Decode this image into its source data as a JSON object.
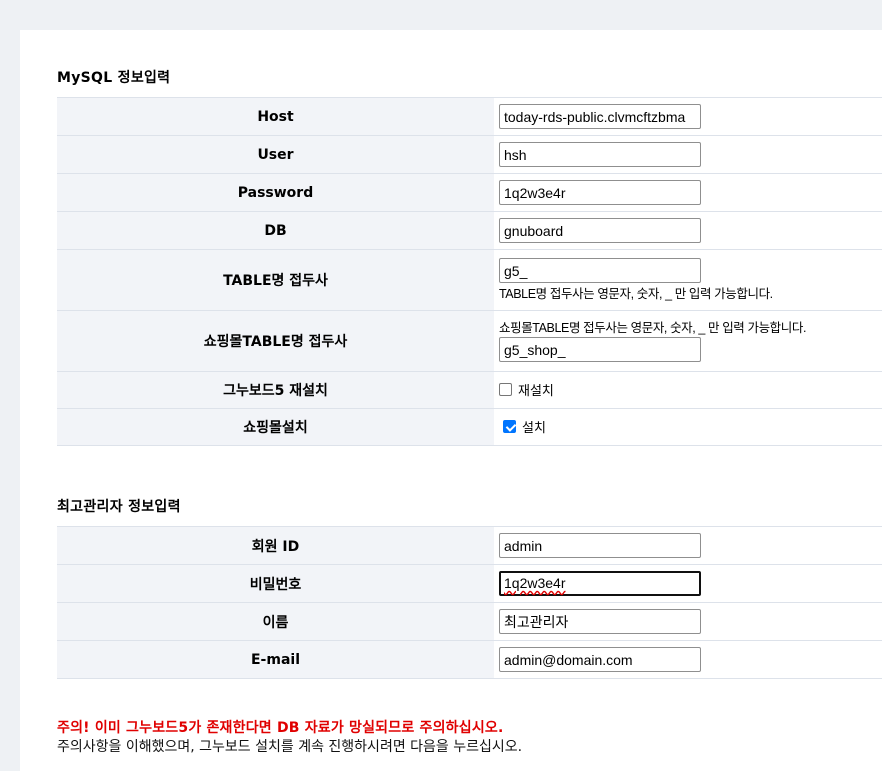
{
  "mysql": {
    "title": "MySQL 정보입력",
    "host_label": "Host",
    "host_value": "today-rds-public.clvmcftzbma",
    "user_label": "User",
    "user_value": "hsh",
    "password_label": "Password",
    "password_value": "1q2w3e4r",
    "db_label": "DB",
    "db_value": "gnuboard",
    "prefix_label": "TABLE명 접두사",
    "prefix_value": "g5_",
    "prefix_help": "TABLE명 접두사는 영문자, 숫자, _ 만 입력 가능합니다.",
    "shop_prefix_label": "쇼핑몰TABLE명 접두사",
    "shop_prefix_help": "쇼핑몰TABLE명 접두사는 영문자, 숫자, _ 만 입력 가능합니다.",
    "shop_prefix_value": "g5_shop_",
    "reinstall_label": "그누보드5 재설치",
    "reinstall_check_label": "재설치",
    "reinstall_checked": false,
    "shop_install_label": "쇼핑몰설치",
    "shop_install_check_label": "설치",
    "shop_install_checked": true
  },
  "admin": {
    "title": "최고관리자 정보입력",
    "id_label": "회원 ID",
    "id_value": "admin",
    "password_label": "비밀번호",
    "password_value": "1q2w3e4r",
    "name_label": "이름",
    "name_value": "최고관리자",
    "email_label": "E-mail",
    "email_value": "admin@domain.com"
  },
  "warning": "주의! 이미 그누보드5가 존재한다면 DB 자료가 망실되므로 주의하십시오.",
  "notice": "주의사항을 이해했으며, 그누보드 설치를 계속 진행하시려면 다음을 누르십시오.",
  "colors": {
    "warning": "#e00000",
    "checkbox_accent": "#0075ff",
    "label_bg": "#f2f4f8"
  }
}
